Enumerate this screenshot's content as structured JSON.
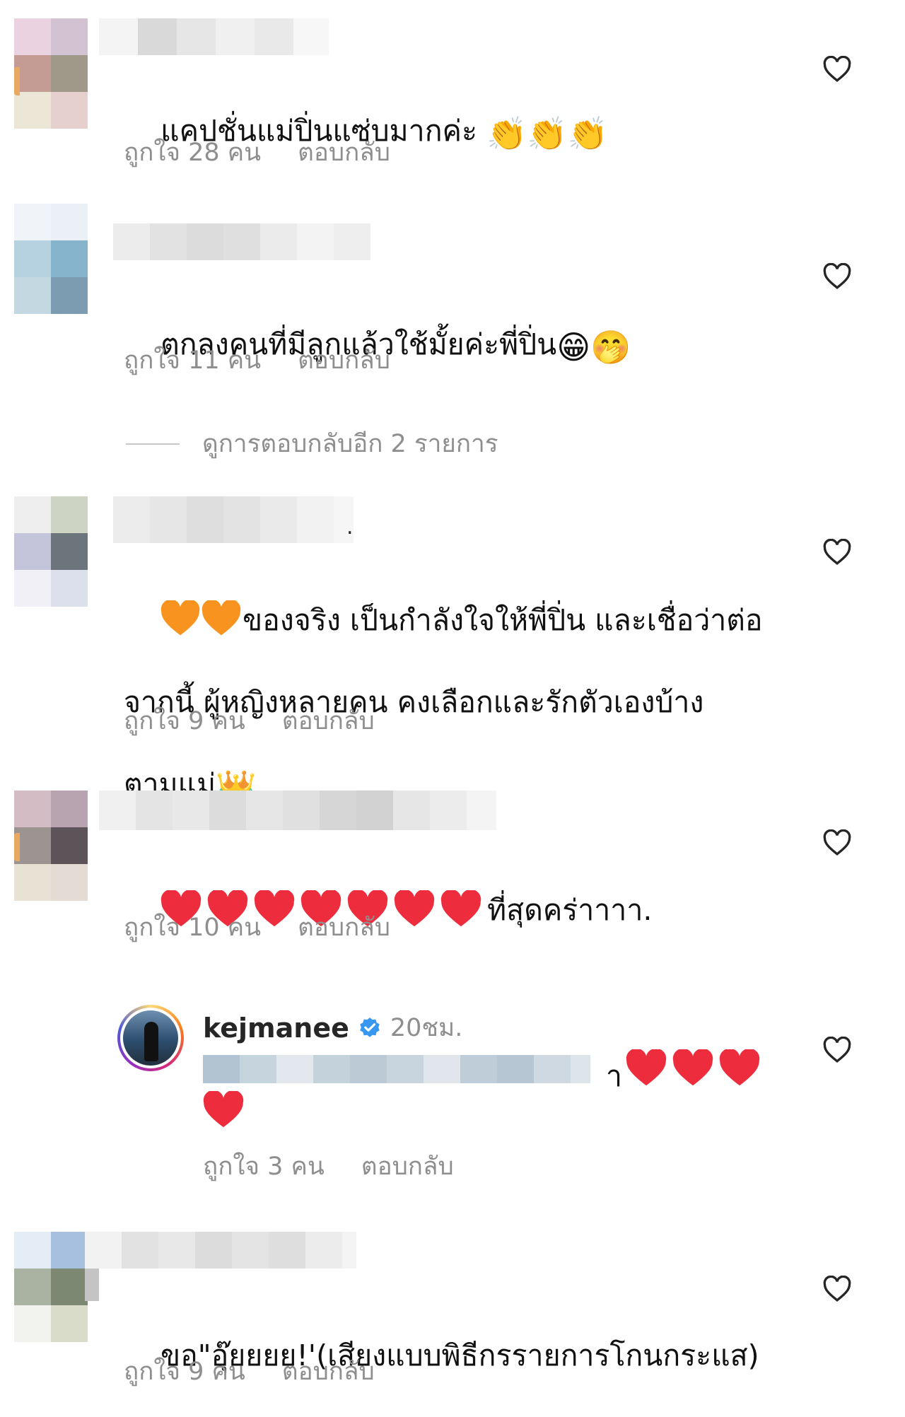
{
  "comments": [
    {
      "text": "แคปชั่นแม่ปิ่นแซ่บมากค่ะ",
      "emoji": "👏👏👏",
      "likes": "ถูกใจ 28 คน",
      "reply": "ตอบกลับ"
    },
    {
      "text": "ตกลงคนที่มีลูกแล้วใช้มั้ยค่ะพี่ปิ่น",
      "emoji": "😁🤭",
      "likes": "ถูกใจ 11 คน",
      "reply": "ตอบกลับ"
    },
    {
      "username_tail": ".",
      "line1": "ของจริง เป็นกำลังใจให้พี่ปิ่น และเชื่อว่าต่อ",
      "line2": "จากนี้ ผู้หญิงหลายคน คงเลือกและรักตัวเองบ้าง",
      "line3": "ตามแม่",
      "crown": "👑",
      "likes": "ถูกใจ 9 คน",
      "reply": "ตอบกลับ"
    },
    {
      "text": "ที่สุดคร่าาาา.",
      "heart_count": 7,
      "likes": "ถูกใจ 10 คน",
      "reply": "ตอบกลับ"
    },
    {
      "text": "ขอ\"อุ๊ยยยย!'(เสียงแบบพิธีกรรายการโกนกระแส)",
      "likes": "ถูกใจ 9 คน",
      "reply": "ตอบกลับ"
    }
  ],
  "view_replies": "ดูการตอบกลับอีก 2 รายการ",
  "owner_reply": {
    "username": "kejmanee",
    "verified": true,
    "time": "20ชม.",
    "mention_tail": " า",
    "heart_count": 4,
    "likes": "ถูกใจ 3 คน",
    "reply": "ตอบกลับ"
  },
  "colors": {
    "meta_gray": "#8e8e8e",
    "verified_blue": "#3897f0",
    "heart_red": "#ed2d3d",
    "heart_orange": "#f7931e"
  },
  "icons": {
    "like": "heart-outline-icon",
    "verified": "verified-badge-icon"
  }
}
